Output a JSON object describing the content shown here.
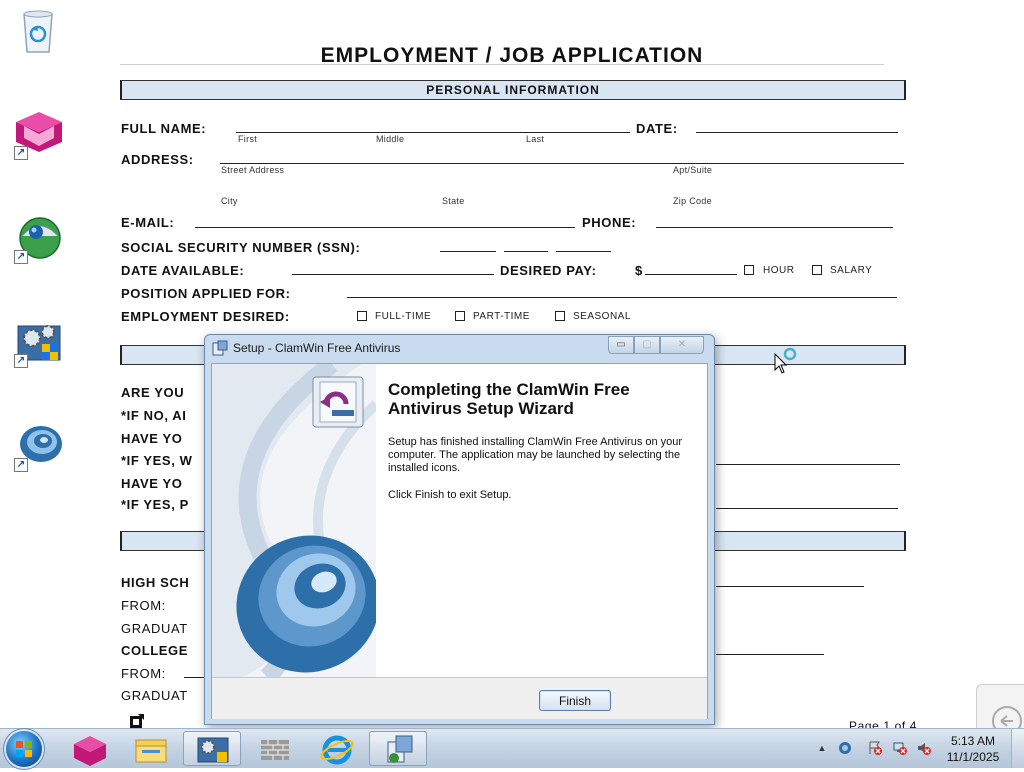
{
  "wallpaper": {
    "title": "EMPLOYMENT / JOB APPLICATION",
    "section_personal": "PERSONAL INFORMATION",
    "full_name": "FULL NAME:",
    "first": "First",
    "middle": "Middle",
    "last": "Last",
    "date": "DATE:",
    "address": "ADDRESS:",
    "street": "Street Address",
    "apt": "Apt/Suite",
    "city": "City",
    "state": "State",
    "zip": "Zip Code",
    "email": "E-MAIL:",
    "phone": "PHONE:",
    "ssn": "SOCIAL SECURITY NUMBER (SSN):",
    "date_available": "DATE AVAILABLE:",
    "desired_pay": "DESIRED PAY:",
    "dollar": "$",
    "hour": "HOUR",
    "salary": "SALARY",
    "position": "POSITION APPLIED FOR:",
    "employment_desired": "EMPLOYMENT DESIRED:",
    "full_time": "FULL-TIME",
    "part_time": "PART-TIME",
    "seasonal": "SEASONAL",
    "are_you": "ARE YOU",
    "if_no": "*IF NO, AI",
    "have_you_1": "HAVE YO",
    "if_yes_1": "*IF YES, W",
    "have_you_2": "HAVE YO",
    "if_yes_2": "*IF YES, P",
    "high_school": "HIGH SCH",
    "from_1": "FROM:",
    "graduate_1": "GRADUAT",
    "college": "COLLEGE",
    "from_2": "FROM:",
    "graduate_2": "GRADUAT",
    "page": "Page 1 of 4"
  },
  "dialog": {
    "title": "Setup - ClamWin Free Antivirus",
    "heading": "Completing the ClamWin Free Antivirus Setup Wizard",
    "body": "Setup has finished installing ClamWin Free Antivirus on your computer. The application may be launched by selecting the installed icons.",
    "body2": "Click Finish to exit Setup.",
    "finish_label": "Finish",
    "minimize_glyph": "▭",
    "maximize_glyph": "▢",
    "close_glyph": "✕"
  },
  "taskbar": {
    "time": "5:13 AM",
    "date": "11/1/2025",
    "tray_expand_glyph": "▲"
  },
  "desktop_icons": [
    {
      "icon": "recycle-bin-icon"
    },
    {
      "icon": "pink-app-shortcut-icon"
    },
    {
      "icon": "network-globe-shortcut-icon"
    },
    {
      "icon": "control-panel-settings-shortcut-icon"
    },
    {
      "icon": "clamwin-shortcut-icon"
    }
  ],
  "colors": {
    "form_bar": "#d9e5f3",
    "dialog_frame": "#c9dbee",
    "clamwin_blue": "#2d6fa8"
  }
}
